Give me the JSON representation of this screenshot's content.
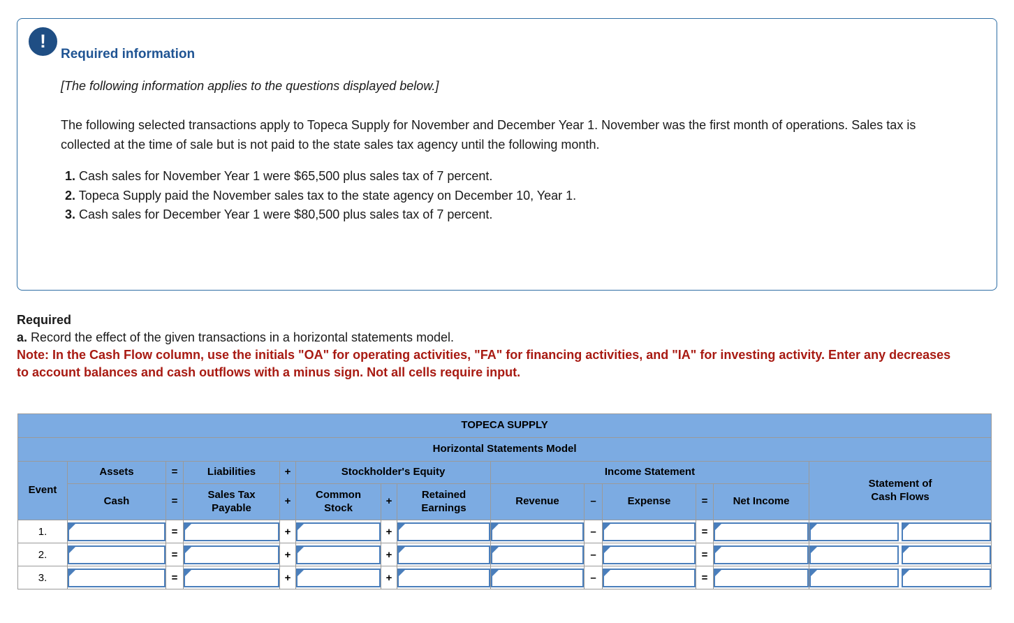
{
  "alert": {
    "icon": "exclamation-icon",
    "title": "Required information",
    "italic_note": "[The following information applies to the questions displayed below.]",
    "paragraph": "The following selected transactions apply to Topeca Supply for November and December Year 1. November was the first month of operations. Sales tax is collected at the time of sale but is not paid to the state sales tax agency until the following month.",
    "items": [
      {
        "n": "1.",
        "text": "Cash sales for November Year 1 were $65,500 plus sales tax of 7 percent."
      },
      {
        "n": "2.",
        "text": "Topeca Supply paid the November sales tax to the state agency on December 10, Year 1."
      },
      {
        "n": "3.",
        "text": "Cash sales for December Year 1 were $80,500 plus sales tax of 7 percent."
      }
    ]
  },
  "required": {
    "heading": "Required",
    "a_label": "a.",
    "a_text": "Record the effect of the given transactions in a horizontal statements model.",
    "note": "Note: In the Cash Flow column, use the initials \"OA\" for operating activities, \"FA\" for financing activities, and \"IA\" for investing activity. Enter any decreases to account balances and cash outflows with a minus sign. Not all cells require input."
  },
  "table": {
    "company": "TOPECA SUPPLY",
    "subtitle": "Horizontal Statements Model",
    "event_header": "Event",
    "groups": {
      "assets": "Assets",
      "eq1": "=",
      "liabilities": "Liabilities",
      "plus1": "+",
      "stockholders_equity": "Stockholder's Equity",
      "income_statement": "Income Statement",
      "statement_of_cash_flows": "Statement of\nCash Flows",
      "scf_line1": "Statement of",
      "scf_line2": "Cash Flows"
    },
    "columns": {
      "cash": "Cash",
      "eq2": "=",
      "sales_tax_payable_l1": "Sales Tax",
      "sales_tax_payable_l2": "Payable",
      "plus2": "+",
      "common_stock_l1": "Common",
      "common_stock_l2": "Stock",
      "plus3": "+",
      "retained_earnings_l1": "Retained",
      "retained_earnings_l2": "Earnings",
      "revenue": "Revenue",
      "minus": "–",
      "expense": "Expense",
      "eq3": "=",
      "net_income": "Net Income"
    },
    "rows": [
      {
        "event": "1.",
        "cash": "",
        "sales_tax_payable": "",
        "common_stock": "",
        "retained_earnings": "",
        "revenue": "",
        "expense": "",
        "net_income": "",
        "cash_flow_amount": "",
        "cash_flow_activity": ""
      },
      {
        "event": "2.",
        "cash": "",
        "sales_tax_payable": "",
        "common_stock": "",
        "retained_earnings": "",
        "revenue": "",
        "expense": "",
        "net_income": "",
        "cash_flow_amount": "",
        "cash_flow_activity": ""
      },
      {
        "event": "3.",
        "cash": "",
        "sales_tax_payable": "",
        "common_stock": "",
        "retained_earnings": "",
        "revenue": "",
        "expense": "",
        "net_income": "",
        "cash_flow_amount": "",
        "cash_flow_activity": ""
      }
    ],
    "row_operators": {
      "eq": "=",
      "plus": "+",
      "minus": "–"
    }
  },
  "colors": {
    "header_blue": "#7cabe2",
    "badge_blue": "#1f4e84",
    "card_border": "#2e6da4",
    "title_blue": "#1f5493",
    "note_red": "#a81a12",
    "input_border": "#4a7ebb"
  }
}
